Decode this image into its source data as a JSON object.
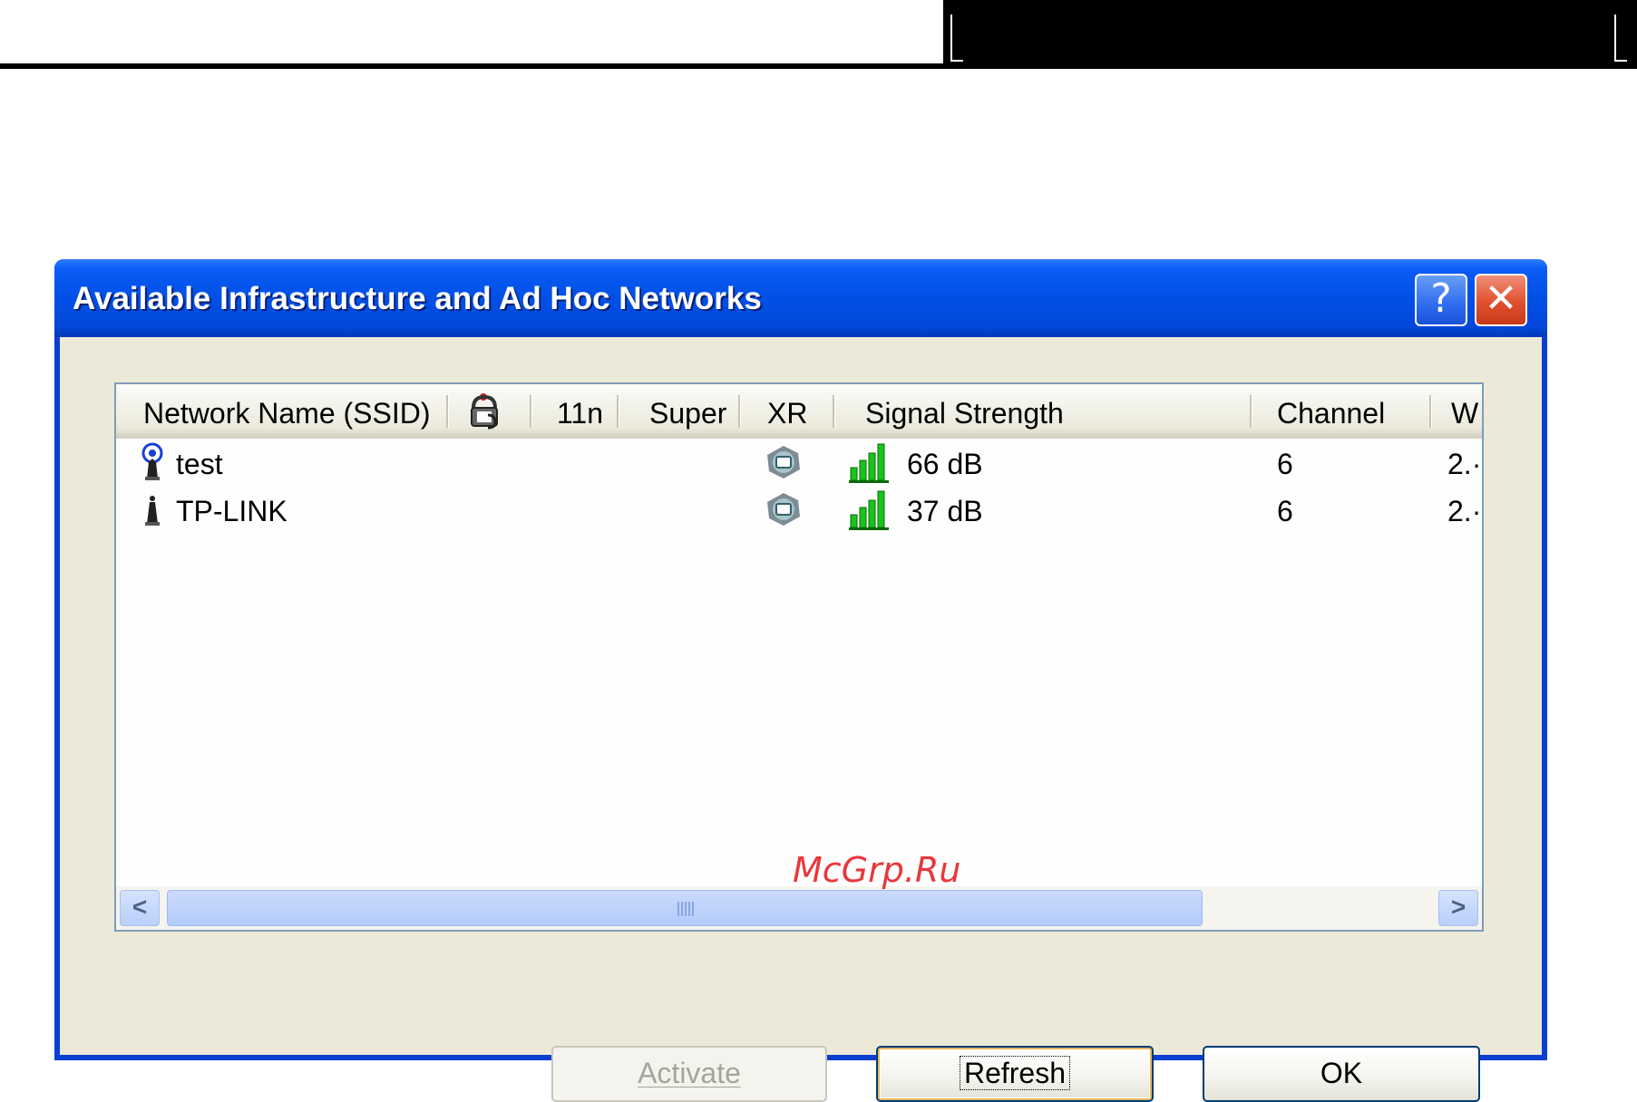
{
  "dialog": {
    "title": "Available Infrastructure and Ad Hoc Networks",
    "help_glyph": "?",
    "close_glyph": "✕"
  },
  "list": {
    "columns": [
      {
        "label": "Network Name (SSID)"
      },
      {
        "label": "",
        "icon": "lock-icon"
      },
      {
        "label": "11n"
      },
      {
        "label": "Super"
      },
      {
        "label": "XR"
      },
      {
        "label": "Signal Strength"
      },
      {
        "label": "Channel"
      },
      {
        "label": "W"
      }
    ],
    "rows": [
      {
        "type_icon": "adhoc-antenna-icon",
        "ssid": "test",
        "xr_icon": "xr-icon",
        "signal_icon": "signal-bars-icon",
        "signal": "66 dB",
        "channel": "6",
        "wireless_mode": "2.·"
      },
      {
        "type_icon": "access-point-icon",
        "ssid": "TP-LINK",
        "xr_icon": "xr-icon",
        "signal_icon": "signal-bars-icon",
        "signal": "37 dB",
        "channel": "6",
        "wireless_mode": "2.·"
      }
    ]
  },
  "scrollbar": {
    "left_arrow": "<",
    "right_arrow": ">"
  },
  "buttons": {
    "activate": "Activate",
    "refresh": "Refresh",
    "ok": "OK"
  },
  "watermark": "McGrp.Ru",
  "colors": {
    "titlebar": "#0150e6",
    "client_bg": "#ece9d8",
    "signal_green": "#19c41a",
    "close_red": "#e0502e"
  }
}
